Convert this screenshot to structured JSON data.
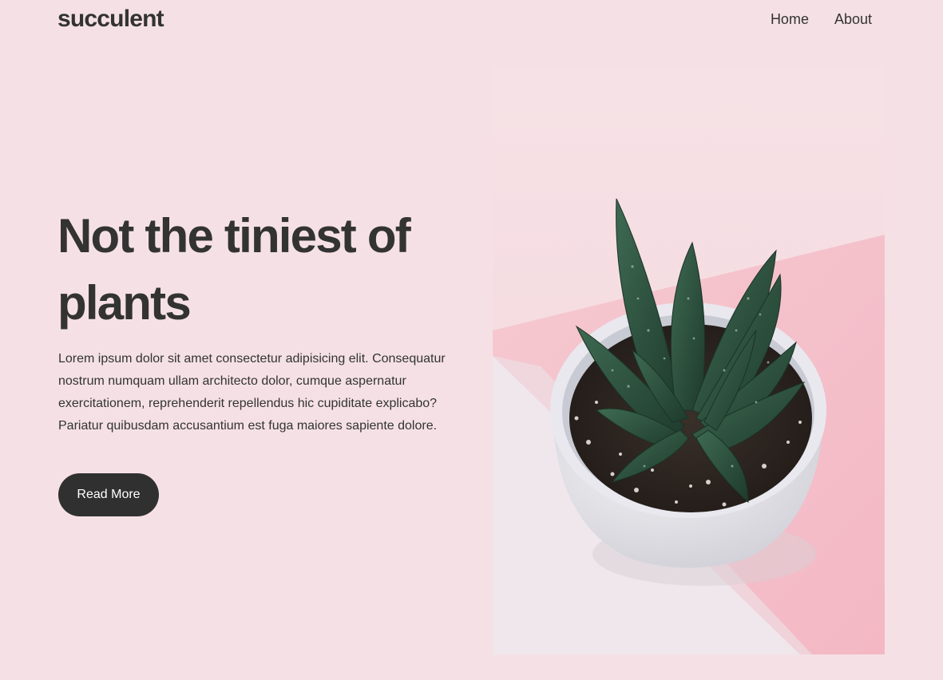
{
  "header": {
    "logo": "succulent",
    "nav": [
      {
        "label": "Home"
      },
      {
        "label": "About"
      }
    ]
  },
  "hero": {
    "title": "Not the tiniest of plants",
    "body": "Lorem ipsum dolor sit amet consectetur adipisicing elit. Consequatur nostrum numquam ullam architecto dolor, cumque aspernatur exercitationem, reprehenderit repellendus hic cupiditate explicabo? Pariatur quibusdam accusantium est fuga maiores sapiente dolore.",
    "button_label": "Read More",
    "image": "potted-succulent-photo"
  },
  "colors": {
    "background": "#f5e1e5",
    "text": "#333333",
    "button": "#303030",
    "button_text": "#ffffff"
  }
}
